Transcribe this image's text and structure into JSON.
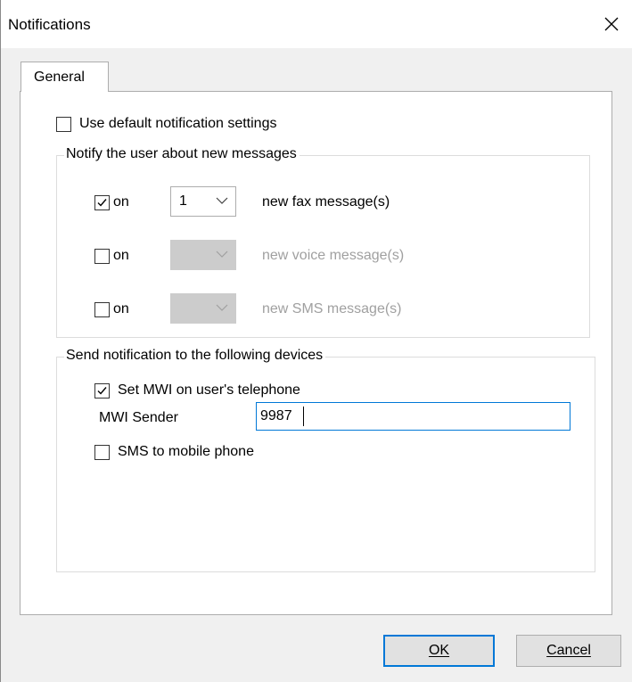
{
  "window": {
    "title": "Notifications"
  },
  "tabs": [
    {
      "label": "General"
    }
  ],
  "general": {
    "use_default": {
      "label": "Use default notification settings",
      "checked": false
    },
    "notify_group": {
      "title": "Notify the user about new messages",
      "rows": [
        {
          "checkbox_label": "on",
          "checked": true,
          "count": "1",
          "enabled": true,
          "text": "new fax message(s)"
        },
        {
          "checkbox_label": "on",
          "checked": false,
          "count": "",
          "enabled": false,
          "text": "new voice message(s)"
        },
        {
          "checkbox_label": "on",
          "checked": false,
          "count": "",
          "enabled": false,
          "text": "new SMS message(s)"
        }
      ]
    },
    "devices_group": {
      "title": "Send notification to the following devices",
      "set_mwi": {
        "label": "Set MWI on user's telephone",
        "checked": true
      },
      "mwi_sender": {
        "label": "MWI Sender",
        "value": "9987"
      },
      "sms_mobile": {
        "label": "SMS to mobile phone",
        "checked": false
      }
    }
  },
  "buttons": {
    "ok": "OK",
    "cancel": "Cancel"
  }
}
